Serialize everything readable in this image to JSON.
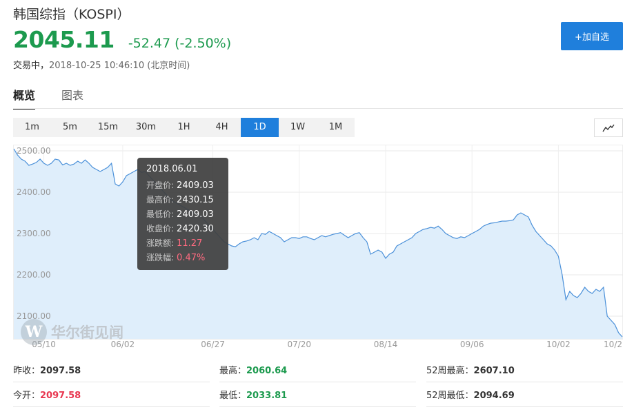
{
  "header": {
    "title": "韩国综指（KOSPI）",
    "price": "2045.11",
    "change": "-52.47 (-2.50%)",
    "state": "交易中，",
    "datetime": "2018-10-25 10:46:10 (北京时间)",
    "add_button": "+加自选"
  },
  "tabs": [
    {
      "label": "概览",
      "active": true
    },
    {
      "label": "图表",
      "active": false
    }
  ],
  "periods": [
    {
      "label": "1m"
    },
    {
      "label": "5m"
    },
    {
      "label": "15m"
    },
    {
      "label": "30m"
    },
    {
      "label": "1H"
    },
    {
      "label": "4H"
    },
    {
      "label": "1D",
      "active": true
    },
    {
      "label": "1W"
    },
    {
      "label": "1M"
    }
  ],
  "chart_type_icon": "line-chart-icon",
  "tooltip": {
    "date": "2018.06.01",
    "rows": [
      {
        "key": "开盘价:",
        "value": "2409.03",
        "color": "plain"
      },
      {
        "key": "最高价:",
        "value": "2430.15",
        "color": "plain"
      },
      {
        "key": "最低价:",
        "value": "2409.03",
        "color": "plain"
      },
      {
        "key": "收盘价:",
        "value": "2420.30",
        "color": "plain"
      },
      {
        "key": "涨跌额:",
        "value": "11.27",
        "color": "red"
      },
      {
        "key": "涨跌幅:",
        "value": "0.47%",
        "color": "red"
      }
    ]
  },
  "watermark": {
    "logo": "W",
    "text": "华尔街见闻"
  },
  "chart_data": {
    "type": "area",
    "ylim": [
      2045,
      2515
    ],
    "yticks": [
      2500,
      2400,
      2300,
      2200,
      2100
    ],
    "ytick_labels": [
      "2500.00",
      "2400.00",
      "2300.00",
      "2200.00",
      "2100.00"
    ],
    "x_labels": [
      {
        "label": "05/10",
        "index": 8
      },
      {
        "label": "06/02",
        "index": 29
      },
      {
        "label": "06/27",
        "index": 53
      },
      {
        "label": "07/20",
        "index": 76
      },
      {
        "label": "08/14",
        "index": 99
      },
      {
        "label": "09/06",
        "index": 122
      },
      {
        "label": "10/02",
        "index": 145
      },
      {
        "label": "10/2",
        "index": 165
      }
    ],
    "values": [
      2505,
      2490,
      2480,
      2475,
      2465,
      2468,
      2472,
      2480,
      2470,
      2465,
      2470,
      2480,
      2478,
      2466,
      2470,
      2465,
      2468,
      2475,
      2470,
      2478,
      2470,
      2460,
      2455,
      2450,
      2455,
      2460,
      2470,
      2420,
      2415,
      2425,
      2440,
      2445,
      2450,
      2455,
      2448,
      2450,
      2440,
      2430,
      2420,
      2410,
      2400,
      2390,
      2380,
      2375,
      2370,
      2365,
      2360,
      2355,
      2350,
      2345,
      2340,
      2330,
      2320,
      2310,
      2300,
      2290,
      2280,
      2275,
      2270,
      2268,
      2275,
      2280,
      2282,
      2285,
      2290,
      2285,
      2300,
      2298,
      2305,
      2300,
      2295,
      2290,
      2280,
      2285,
      2290,
      2290,
      2288,
      2292,
      2292,
      2288,
      2285,
      2290,
      2295,
      2292,
      2295,
      2298,
      2300,
      2302,
      2296,
      2290,
      2295,
      2300,
      2302,
      2290,
      2280,
      2250,
      2255,
      2260,
      2255,
      2240,
      2250,
      2255,
      2270,
      2275,
      2280,
      2285,
      2290,
      2300,
      2305,
      2310,
      2312,
      2315,
      2313,
      2318,
      2310,
      2300,
      2295,
      2290,
      2288,
      2292,
      2290,
      2295,
      2300,
      2305,
      2310,
      2318,
      2322,
      2325,
      2326,
      2328,
      2330,
      2330,
      2331,
      2333,
      2345,
      2350,
      2345,
      2340,
      2320,
      2305,
      2295,
      2285,
      2275,
      2270,
      2260,
      2245,
      2200,
      2140,
      2160,
      2150,
      2145,
      2155,
      2170,
      2160,
      2155,
      2165,
      2160,
      2170,
      2100,
      2090,
      2080,
      2060,
      2050
    ]
  },
  "stats": [
    [
      {
        "label": "昨收：",
        "value": "2097.58",
        "color": "plain"
      },
      {
        "label": "最高：",
        "value": "2060.64",
        "color": "green"
      },
      {
        "label": "52周最高：",
        "value": "2607.10",
        "color": "plain"
      }
    ],
    [
      {
        "label": "今开：",
        "value": "2097.58",
        "color": "red"
      },
      {
        "label": "最低：",
        "value": "2033.81",
        "color": "green"
      },
      {
        "label": "52周最低：",
        "value": "2094.69",
        "color": "plain"
      }
    ]
  ]
}
